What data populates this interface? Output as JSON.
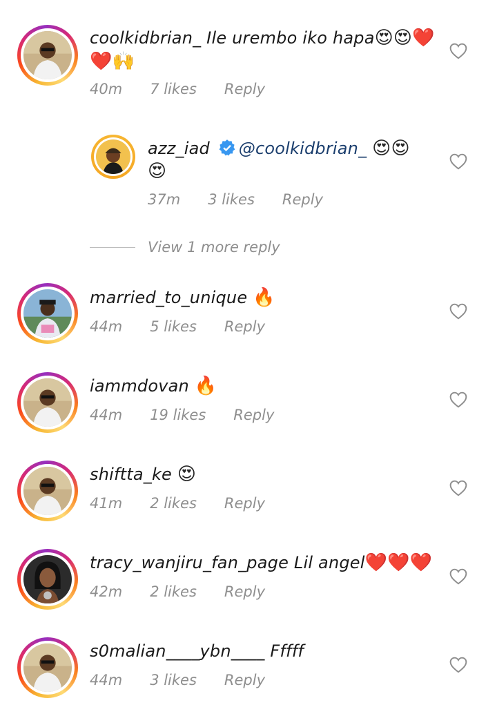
{
  "comments": [
    {
      "username": "coolkidbrian_",
      "text": "Ile urembo iko hapa",
      "emoji": "😍😍❤️",
      "emoji2": "❤️🙌",
      "time": "40m",
      "likes": "7 likes",
      "reply": "Reply"
    },
    {
      "username": "azz_iad",
      "mention": "@coolkidbrian_",
      "emoji": "😍😍",
      "emoji2": "😍",
      "time": "37m",
      "likes": "3 likes",
      "reply": "Reply"
    },
    {
      "username": "married_to_unique",
      "emoji": "🔥",
      "time": "44m",
      "likes": "5 likes",
      "reply": "Reply"
    },
    {
      "username": "iammdovan",
      "emoji": "🔥",
      "time": "44m",
      "likes": "19 likes",
      "reply": "Reply"
    },
    {
      "username": "shiftta_ke",
      "emoji": "😍",
      "time": "41m",
      "likes": "2 likes",
      "reply": "Reply"
    },
    {
      "username": "tracy_wanjiru_fan_page",
      "text": "Lil angel",
      "emoji": "❤️❤️❤️",
      "time": "42m",
      "likes": "2 likes",
      "reply": "Reply"
    },
    {
      "username": "s0malian____ybn____",
      "text": "Fffff",
      "time": "44m",
      "likes": "3 likes",
      "reply": "Reply"
    }
  ],
  "view_more": "View 1 more reply",
  "icons": {
    "like": "heart-outline-icon",
    "verified": "verified-badge-icon"
  },
  "colors": {
    "ring_start": "#feda75",
    "ring_mid": "#d62976",
    "ring_end": "#962fbf",
    "meta_gray": "#8e8e8e",
    "mention": "#1c3f6e",
    "verified_blue": "#3897f0"
  }
}
